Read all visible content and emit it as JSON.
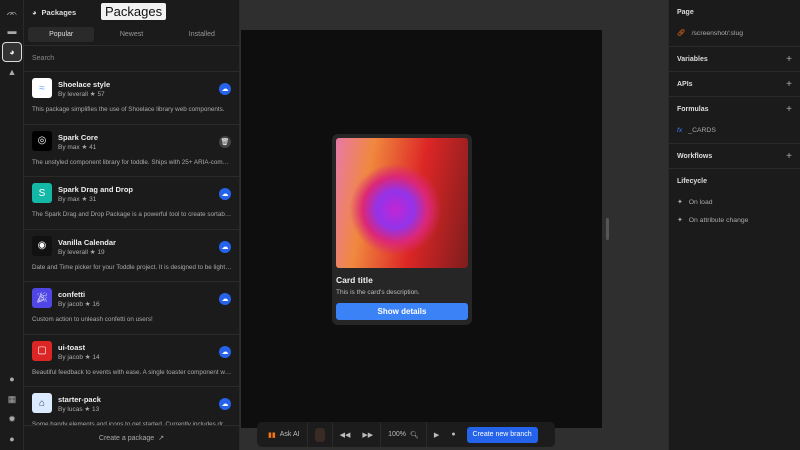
{
  "rail": {
    "icons": [
      "toddle-logo-icon",
      "folder-icon",
      "packages-icon",
      "warning-icon"
    ],
    "bottom_icons": [
      "palette-icon",
      "gift-icon",
      "bug-icon",
      "help-icon"
    ]
  },
  "panel": {
    "title": "Packages",
    "tooltip": "Packages",
    "tabs": [
      "Popular",
      "Newest",
      "Installed"
    ],
    "search_placeholder": "Search",
    "items": [
      {
        "name": "Shoelace style",
        "by": "By leverall",
        "stars": "57",
        "desc": "This package simplifies the use of Shoelace library web components.",
        "action": "install"
      },
      {
        "name": "Spark Core",
        "by": "By max",
        "stars": "41",
        "desc": "The unstyled component library for toddle. Ships with 25+ ARIA-compliant,...",
        "action": "delete"
      },
      {
        "name": "Spark Drag and Drop",
        "by": "By max",
        "stars": "31",
        "desc": "The Spark Drag and Drop Package is a powerful tool to create sortable list...",
        "action": "install"
      },
      {
        "name": "Vanilla Calendar",
        "by": "By leverall",
        "stars": "19",
        "desc": "Date and Time picker for your Toddle project. It is designed to be lightweig...",
        "action": "install"
      },
      {
        "name": "confetti",
        "by": "By jacob",
        "stars": "16",
        "desc": "Custom action to unleash confetti on users!",
        "action": "install"
      },
      {
        "name": "ui-toast",
        "by": "By jacob",
        "stars": "14",
        "desc": "Beautiful feedback to events with ease. A single toaster component with th...",
        "action": "install"
      },
      {
        "name": "starter-pack",
        "by": "By lucas",
        "stars": "13",
        "desc": "Some handy elements and icons to get started. Currently includes dropdo...",
        "action": "install"
      }
    ],
    "footer": "Create a package"
  },
  "card": {
    "title": "Card title",
    "description": "This is the card's description.",
    "button": "Show details"
  },
  "toolbar": {
    "ask_ai": "Ask AI",
    "zoom": "100%",
    "create_branch": "Create new branch"
  },
  "right": {
    "page_label": "Page",
    "slug": "/screenshot/:slug",
    "variables": "Variables",
    "apis": "APIs",
    "formulas": "Formulas",
    "formula_item": "_CARDS",
    "workflows": "Workflows",
    "lifecycle": "Lifecycle",
    "on_load": "On load",
    "on_attr": "On attribute change"
  }
}
